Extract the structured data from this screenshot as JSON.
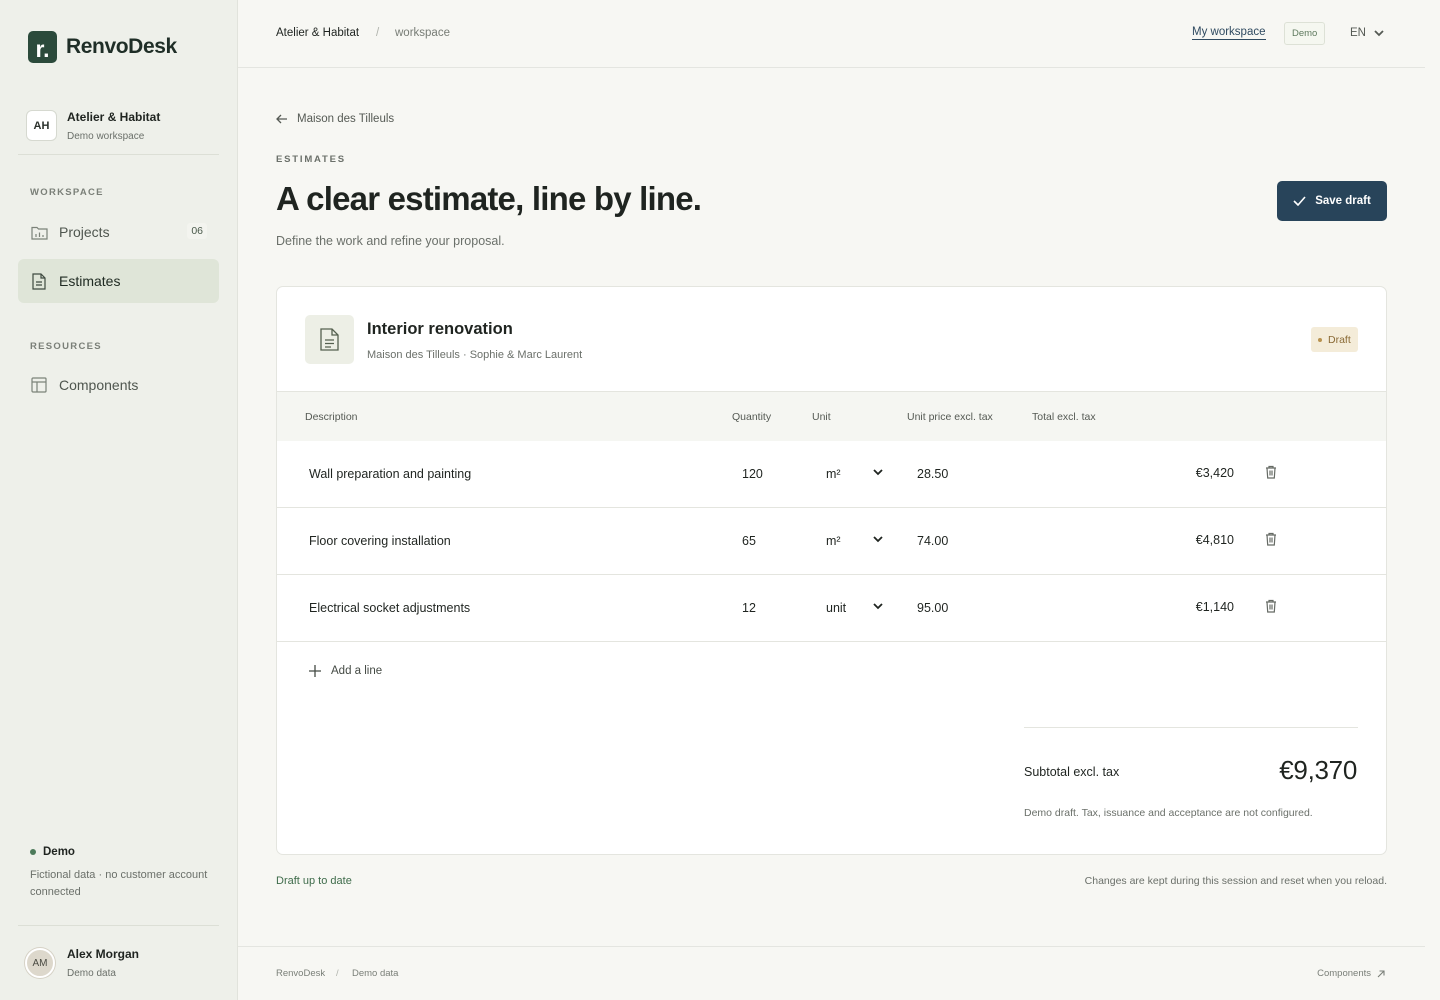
{
  "brand": {
    "mark": "r.",
    "name": "RenvoDesk",
    "accent": "#2b4a3b"
  },
  "workspace_card": {
    "initials": "AH",
    "name": "Atelier & Habitat",
    "subtitle": "Demo workspace"
  },
  "sidebar": {
    "workspace_label": "WORKSPACE",
    "resources_label": "RESOURCES",
    "items": [
      {
        "label": "Projects",
        "icon": "folder-icon",
        "count": "06",
        "active": false
      },
      {
        "label": "Estimates",
        "icon": "document-icon",
        "active": true
      },
      {
        "label": "Components",
        "icon": "layout-icon",
        "active": false
      }
    ],
    "demo": {
      "title": "Demo",
      "text": "Fictional data · no customer account connected"
    },
    "user": {
      "initials": "AM",
      "name": "Alex Morgan",
      "subtitle": "Demo data"
    }
  },
  "topbar": {
    "breadcrumb_main": "Atelier & Habitat",
    "breadcrumb_sep": "/",
    "breadcrumb_sub": "workspace",
    "my_workspace": "My workspace",
    "demo_chip": "Demo",
    "language": "EN"
  },
  "page": {
    "back_label": "Maison des Tilleuls",
    "eyebrow": "ESTIMATES",
    "title": "A clear estimate, line by line.",
    "subtitle": "Define the work and refine your proposal.",
    "save_button": "Save draft",
    "primary_color": "#28445a"
  },
  "estimate": {
    "title": "Interior renovation",
    "subtitle": "Maison des Tilleuls · Sophie & Marc Laurent",
    "status": "Draft",
    "columns": {
      "description": "Description",
      "quantity": "Quantity",
      "unit": "Unit",
      "unit_price": "Unit price excl. tax",
      "total": "Total excl. tax"
    },
    "lines": [
      {
        "description": "Wall preparation and painting",
        "quantity": "120",
        "unit": "m²",
        "unit_price": "28.50",
        "total": "€3,420"
      },
      {
        "description": "Floor covering installation",
        "quantity": "65",
        "unit": "m²",
        "unit_price": "74.00",
        "total": "€4,810"
      },
      {
        "description": "Electrical socket adjustments",
        "quantity": "12",
        "unit": "unit",
        "unit_price": "95.00",
        "total": "€1,140"
      }
    ],
    "add_line": "Add a line",
    "subtotal_label": "Subtotal excl. tax",
    "subtotal_value": "€9,370",
    "totals_note": "Demo draft. Tax, issuance and acceptance are not configured."
  },
  "status_bar": {
    "draft_status": "Draft up to date",
    "session_note": "Changes are kept during this session and reset when you reload."
  },
  "footer": {
    "brand": "RenvoDesk",
    "sep": "/",
    "demo": "Demo data",
    "components": "Components"
  }
}
